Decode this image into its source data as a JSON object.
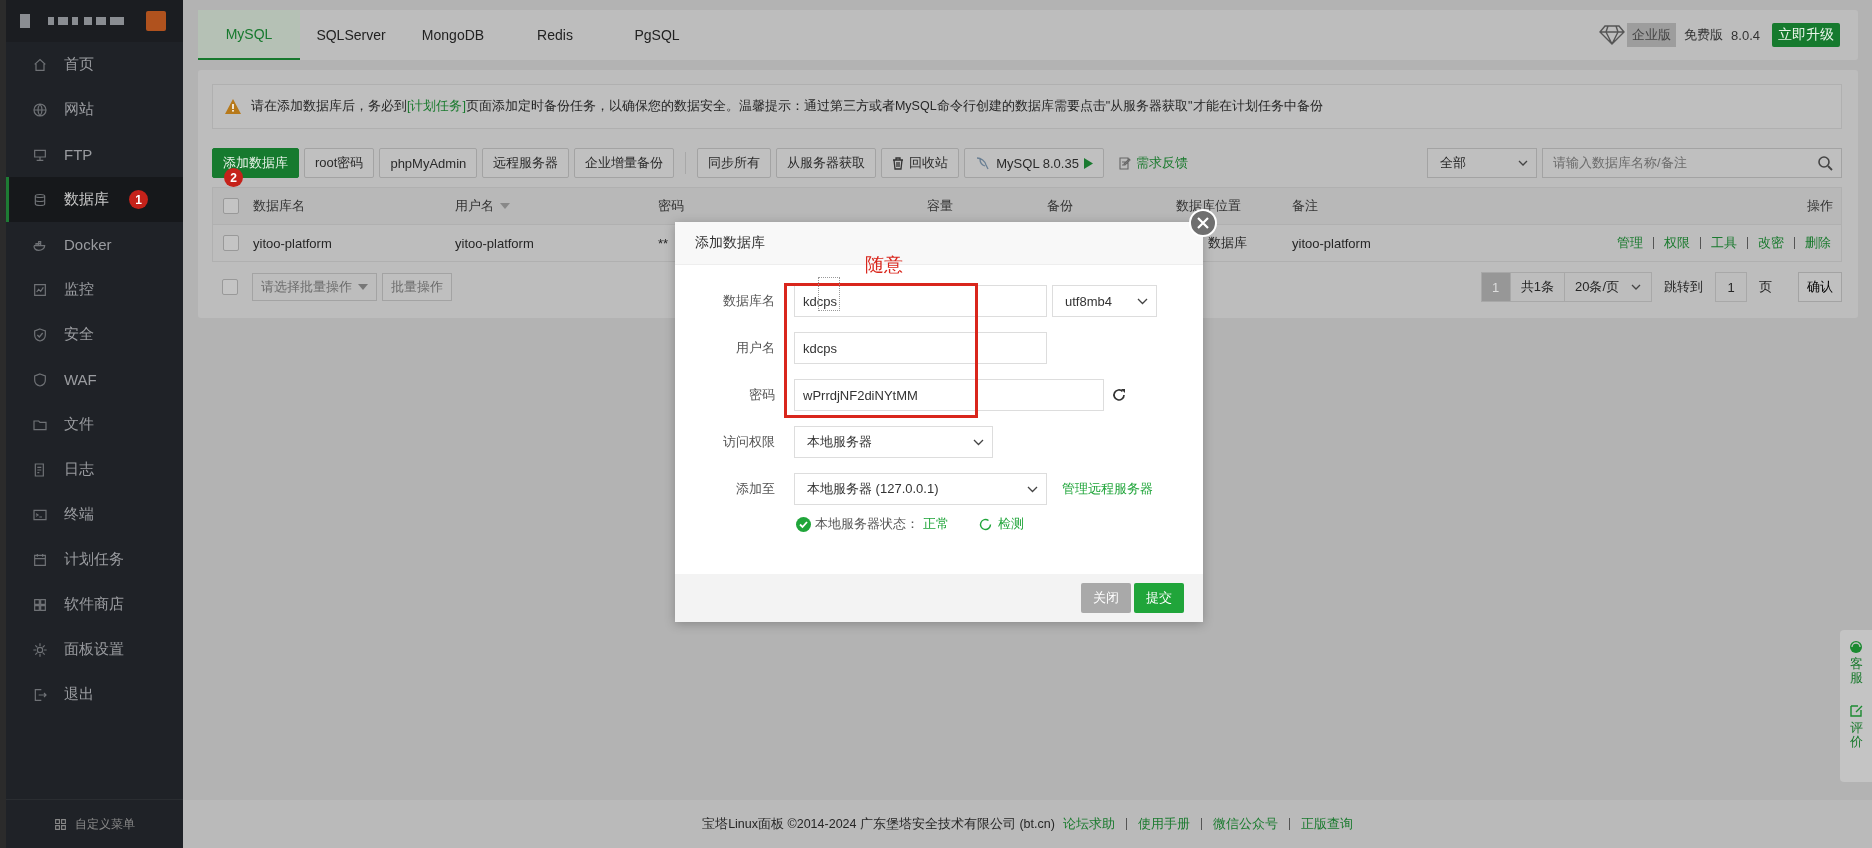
{
  "sidebar": {
    "items": [
      {
        "label": "首页",
        "selected": false
      },
      {
        "label": "网站",
        "selected": false
      },
      {
        "label": "FTP",
        "selected": false
      },
      {
        "label": "数据库",
        "selected": true,
        "badge": "1"
      },
      {
        "label": "Docker",
        "selected": false
      },
      {
        "label": "监控",
        "selected": false
      },
      {
        "label": "安全",
        "selected": false
      },
      {
        "label": "WAF",
        "selected": false
      },
      {
        "label": "文件",
        "selected": false
      },
      {
        "label": "日志",
        "selected": false
      },
      {
        "label": "终端",
        "selected": false
      },
      {
        "label": "计划任务",
        "selected": false
      },
      {
        "label": "软件商店",
        "selected": false
      },
      {
        "label": "面板设置",
        "selected": false
      },
      {
        "label": "退出",
        "selected": false
      }
    ],
    "footer": "自定义菜单"
  },
  "tabs": [
    {
      "label": "MySQL",
      "selected": true
    },
    {
      "label": "SQLServer",
      "selected": false
    },
    {
      "label": "MongoDB",
      "selected": false
    },
    {
      "label": "Redis",
      "selected": false
    },
    {
      "label": "PgSQL",
      "selected": false
    }
  ],
  "edition": {
    "enterprise": "企业版",
    "free": "免费版",
    "version": "8.0.4",
    "upgrade": "立即升级"
  },
  "alert": {
    "before": "请在添加数据库后，务必到",
    "link": "[计划任务]",
    "after": "页面添加定时备份任务，以确保您的数据安全。温馨提示：通过第三方或者MySQL命令行创建的数据库需要点击\"从服务器获取\"才能在计划任务中备份"
  },
  "toolbar": {
    "groups": [
      [
        {
          "label": "添加数据库",
          "kind": "primary",
          "badge": "2"
        },
        {
          "label": "root密码",
          "kind": "default"
        },
        {
          "label": "phpMyAdmin",
          "kind": "default"
        },
        {
          "label": "远程服务器",
          "kind": "default"
        },
        {
          "label": "企业增量备份",
          "kind": "default"
        }
      ],
      [
        {
          "label": "同步所有",
          "kind": "default"
        },
        {
          "label": "从服务器获取",
          "kind": "default"
        },
        {
          "label": "回收站",
          "kind": "trash"
        },
        {
          "label": "MySQL 8.0.35",
          "kind": "version"
        }
      ]
    ],
    "feedback": "需求反馈",
    "filter": "全部",
    "search_placeholder": "请输入数据库名称/备注"
  },
  "table": {
    "select_all": {
      "checked": false
    },
    "columns": [
      {
        "label": "数据库名",
        "sortable": false
      },
      {
        "label": "用户名",
        "sortable": true
      },
      {
        "label": "密码",
        "sortable": false
      },
      {
        "label": "容量",
        "sortable": false
      },
      {
        "label": "备份",
        "sortable": false
      },
      {
        "label": "数据库位置",
        "sortable": false
      },
      {
        "label": "备注",
        "sortable": false
      },
      {
        "label": "操作",
        "sortable": false
      }
    ],
    "rows": [
      {
        "checked": false,
        "cells": [
          "yitoo-platform",
          "yitoo-platform",
          "**",
          "",
          "",
          "数据库",
          "yitoo-platform"
        ],
        "actions": [
          "管理",
          "权限",
          "工具",
          "改密",
          "删除"
        ]
      }
    ]
  },
  "batch": {
    "checked": false,
    "placeholder": "请选择批量操作",
    "button": "批量操作"
  },
  "pagination": {
    "current": "1",
    "total": "共1条",
    "per_page": "20条/页",
    "goto": "跳转到",
    "page_value": "1",
    "page": "页",
    "confirm": "确认"
  },
  "modal": {
    "title": "添加数据库",
    "fields": [
      {
        "kind": "input",
        "label": "数据库名",
        "value": "kdcps",
        "select": "utf8mb4"
      },
      {
        "kind": "input",
        "label": "用户名",
        "value": "kdcps"
      },
      {
        "kind": "password",
        "label": "密码",
        "value": "wPrrdjNF2diNYtMM"
      },
      {
        "kind": "select",
        "label": "访问权限",
        "value": "本地服务器"
      },
      {
        "kind": "select",
        "label": "添加至",
        "value": "本地服务器 (127.0.0.1)",
        "link": "管理远程服务器"
      }
    ],
    "status": {
      "label": "本地服务器状态：",
      "value": "正常",
      "check": "检测"
    },
    "buttons": [
      {
        "label": "关闭",
        "disabled": true
      },
      {
        "label": "提交",
        "disabled": false
      }
    ]
  },
  "annotation": "随意",
  "footer": {
    "copyright": "宝塔Linux面板 ©2014-2024 广东堡塔安全技术有限公司 (bt.cn)",
    "links": [
      "论坛求助",
      "使用手册",
      "微信公众号",
      "正版查询"
    ]
  },
  "side_widget": [
    {
      "label": "客服"
    },
    {
      "label": "评价"
    }
  ]
}
